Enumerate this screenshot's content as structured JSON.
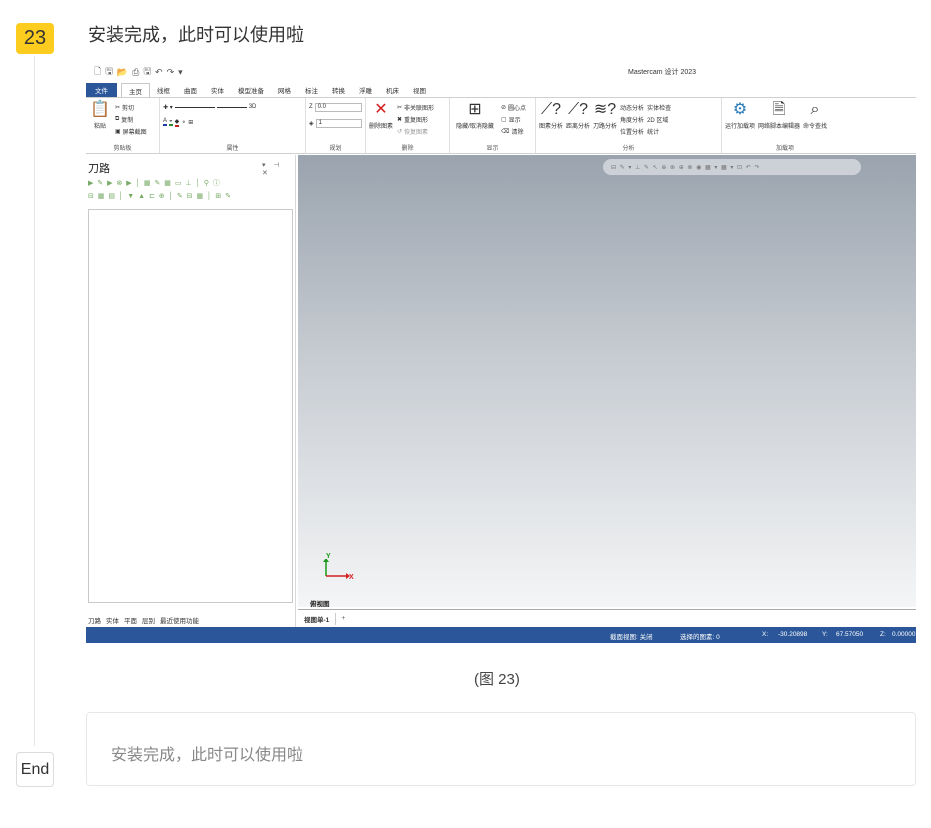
{
  "step": {
    "number": "23",
    "title": "安装完成，此时可以使用啦"
  },
  "app": {
    "title": "Mastercam 设计 2023",
    "ribbon_tabs": [
      "文件",
      "主页",
      "线框",
      "曲面",
      "实体",
      "模型准备",
      "网格",
      "标注",
      "转换",
      "浮雕",
      "机床",
      "视图"
    ],
    "active_tab": "主页",
    "groups": {
      "clipboard": {
        "label": "剪贴板",
        "paste": "粘贴",
        "cut": "剪切",
        "copy": "复制",
        "screenshot": "屏幕截图"
      },
      "attributes": {
        "label": "属性",
        "mode": "3D"
      },
      "planes": {
        "label": "规划",
        "z_label": "Z",
        "z_value": "0.0",
        "level_value": "1"
      },
      "delete": {
        "label": "删除",
        "delete_entity": "删除图素",
        "delete_dup": "重复图形",
        "undelete": "恢复图素",
        "delete_rel": "非关联图形"
      },
      "display": {
        "label": "显示",
        "hide": "隐藏/取消隐藏",
        "centerpoint": "圆心点",
        "show": "显示",
        "clear": "清除"
      },
      "analyze": {
        "label": "分析",
        "entity": "图素分析",
        "distance": "距离分析",
        "toolpath": "刀路分析",
        "dynamic": "动态分析",
        "angle": "角度分析",
        "position": "位置分析",
        "solid_check": "实体检查",
        "area": "2D 区域",
        "stats": "统计"
      },
      "addins": {
        "label": "加载项",
        "run": "运行加载项",
        "editor": "网络脚本编辑器",
        "find": "命令查找"
      }
    },
    "panel": {
      "title": "刀路",
      "tabs": [
        "刀路",
        "实体",
        "平面",
        "层别",
        "最近使用功能"
      ]
    },
    "viewport": {
      "name": "俯视图",
      "axis_y": "Y",
      "axis_x": "X"
    },
    "sheet": {
      "tab": "视图单-1",
      "add": "+"
    },
    "status": {
      "view": "截面视图: 关闭",
      "selected": "选择的图素: 0",
      "x_label": "X:",
      "x_value": "-30.20898",
      "y_label": "Y:",
      "y_value": "67.57050",
      "z_label": "Z:",
      "z_value": "0.00000"
    }
  },
  "caption": "(图 23)",
  "note": "安装完成，此时可以使用啦",
  "end_label": "End",
  "colors": {
    "badge": "#fccc1e",
    "ribbon_blue": "#2b579a"
  }
}
